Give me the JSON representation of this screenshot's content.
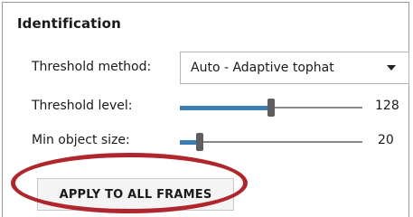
{
  "panel": {
    "title": "Identification"
  },
  "threshold_method": {
    "label": "Threshold method:",
    "selected": "Auto - Adaptive tophat",
    "icon": "chevron-down-icon"
  },
  "threshold_level": {
    "label": "Threshold level:",
    "value": "128",
    "fraction": 0.5
  },
  "min_object_size": {
    "label": "Min object size:",
    "value": "20",
    "fraction": 0.11
  },
  "apply_button": {
    "label": "APPLY TO ALL FRAMES"
  },
  "colors": {
    "slider_fill": "#3c7db3",
    "highlight_ring": "#b0262d"
  }
}
